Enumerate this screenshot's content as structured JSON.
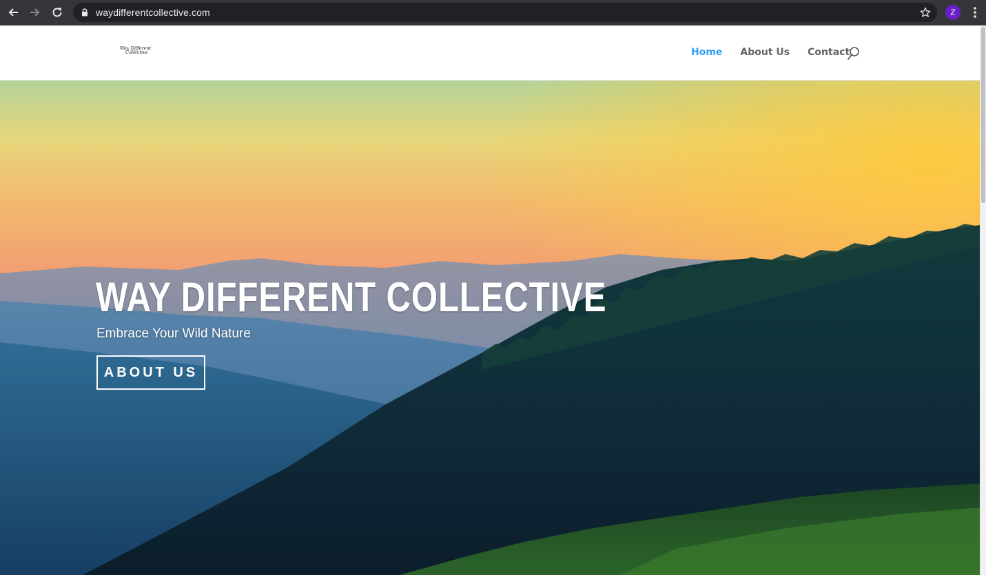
{
  "browser": {
    "url": "waydifferentcollective.com",
    "profile_initial": "Z",
    "profile_color": "#6a1fc9"
  },
  "site": {
    "logo_lines": [
      "Way Different",
      "Collective"
    ],
    "nav": [
      {
        "label": "Home",
        "active": true
      },
      {
        "label": "About Us",
        "active": false
      },
      {
        "label": "Contact",
        "active": false
      }
    ],
    "accent_color": "#2ea3f2"
  },
  "hero": {
    "title": "WAY DIFFERENT COLLECTIVE",
    "subtitle": "Embrace Your Wild Nature",
    "button_label": "ABOUT US"
  },
  "icons": {
    "back": "back-arrow-icon",
    "forward": "forward-arrow-icon",
    "reload": "reload-icon",
    "lock": "lock-icon",
    "bookmark": "star-icon",
    "menu": "more-vert-icon",
    "search": "search-icon"
  }
}
